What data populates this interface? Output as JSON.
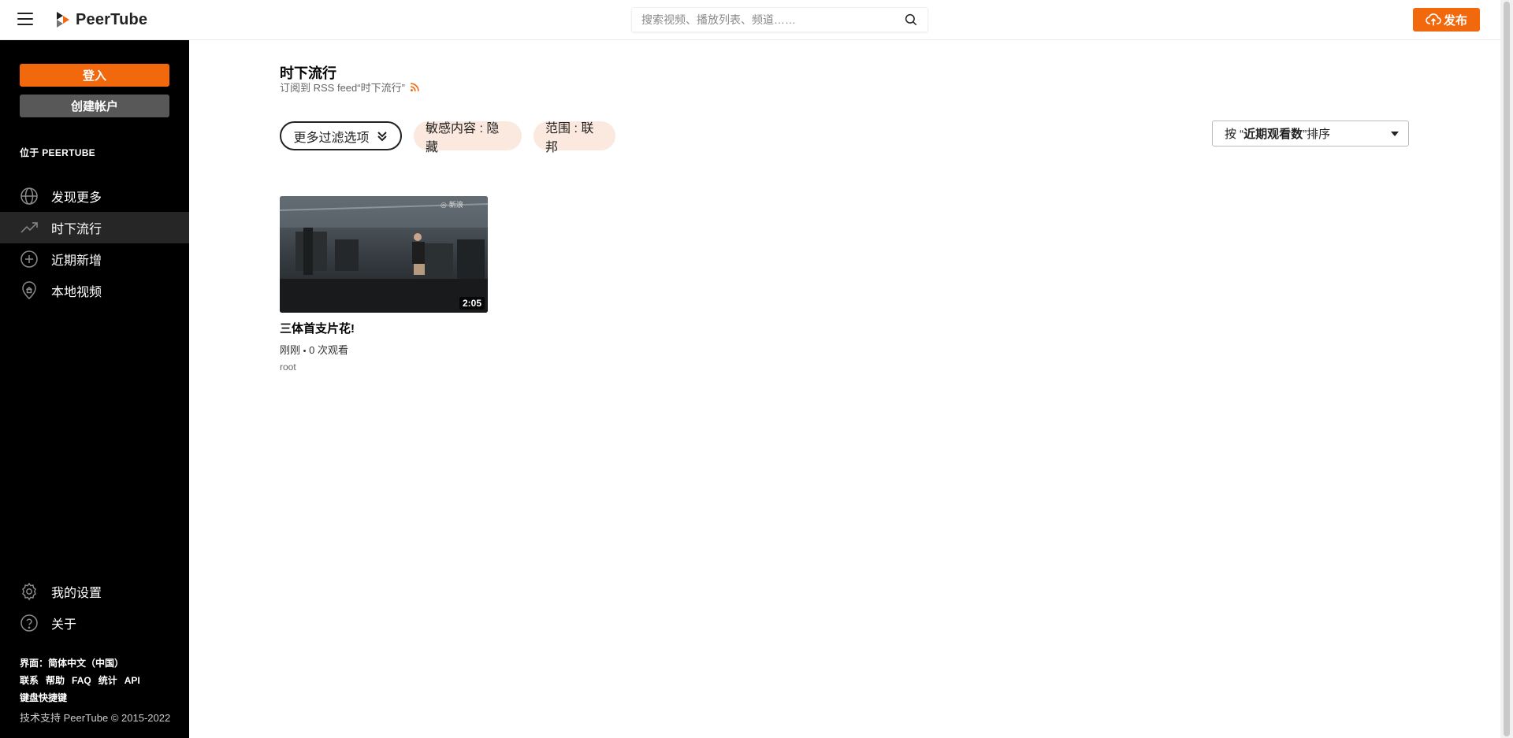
{
  "header": {
    "brand": "PeerTube",
    "search_placeholder": "搜索视频、播放列表、频道……",
    "publish_label": "发布"
  },
  "sidebar": {
    "login_label": "登入",
    "create_account_label": "创建帐户",
    "section_title": "位于 PEERTUBE",
    "items": [
      {
        "label": "发现更多",
        "icon": "globe-icon",
        "active": false
      },
      {
        "label": "时下流行",
        "icon": "trending-icon",
        "active": true
      },
      {
        "label": "近期新增",
        "icon": "plus-circle-icon",
        "active": false
      },
      {
        "label": "本地视频",
        "icon": "home-pin-icon",
        "active": false
      }
    ],
    "bottom_items": [
      {
        "label": "我的设置",
        "icon": "cog-icon"
      },
      {
        "label": "关于",
        "icon": "help-icon"
      }
    ],
    "footer": {
      "language": "界面：简体中文（中国）",
      "links": [
        "联系",
        "帮助",
        "FAQ",
        "统计",
        "API"
      ],
      "shortcuts": "键盘快捷键",
      "copyright": "技术支持 PeerTube © 2015-2022"
    }
  },
  "main": {
    "title": "时下流行",
    "rss_text": "订阅到 RSS feed“时下流行”",
    "filter_button": "更多过滤选项",
    "chips": [
      "敏感内容 : 隐藏",
      "范围 : 联邦"
    ],
    "sort": {
      "prefix": "按 “",
      "bold": "近期观看数",
      "suffix": "”排序"
    },
    "videos": [
      {
        "title": "三体首支片花!",
        "duration": "2:05",
        "published": "刚刚",
        "separator": "•",
        "views": "0 次观看",
        "owner": "root"
      }
    ]
  },
  "colors": {
    "accent": "#f2690d",
    "sidebar_bg": "#000000",
    "chip_bg": "#fbe9df"
  }
}
